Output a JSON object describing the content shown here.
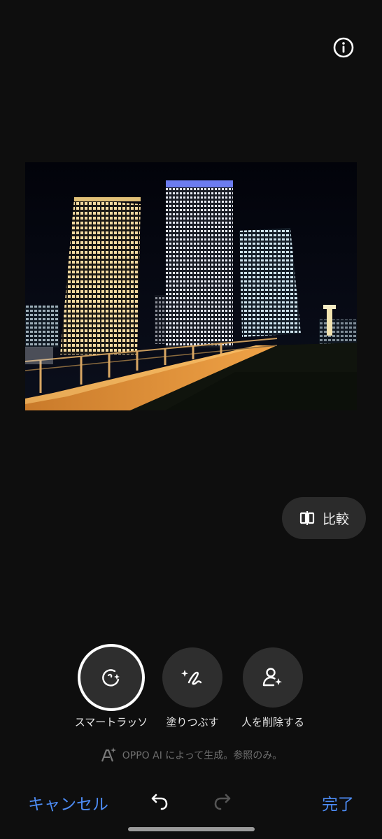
{
  "header": {
    "info_icon": "info-circle-icon"
  },
  "photo": {
    "subject": "night-skyline-photo"
  },
  "compare": {
    "icon": "compare-split-icon",
    "label": "比較"
  },
  "tools": [
    {
      "label": "スマートラッソ",
      "icon": "smart-lasso-icon",
      "selected": true
    },
    {
      "label": "塗りつぶす",
      "icon": "brush-sparkle-icon",
      "selected": false
    },
    {
      "label": "人を削除する",
      "icon": "remove-person-icon",
      "selected": false
    }
  ],
  "disclaimer": {
    "icon": "ai-sparkle-icon",
    "text": "OPPO AI によって生成。参照のみ。"
  },
  "bottom": {
    "cancel_label": "キャンセル",
    "done_label": "完了",
    "undo_icon": "undo-icon",
    "redo_icon": "redo-icon"
  },
  "colors": {
    "accent": "#4d8cf5",
    "background": "#0e0e0e",
    "button_bg": "#2e2e2e"
  }
}
